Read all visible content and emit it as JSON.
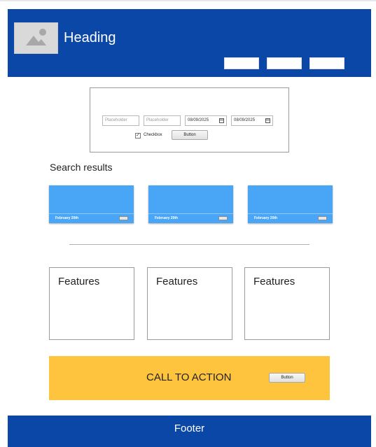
{
  "header": {
    "heading": "Heading",
    "nav_buttons": [
      "",
      "",
      ""
    ]
  },
  "search_form": {
    "field1_placeholder": "Placeholder",
    "field2_placeholder": "Placeholder",
    "date1": "08/09/2025",
    "date2": "08/09/2025",
    "checkbox_label": "Checkbox",
    "checkbox_checked": true,
    "button_label": "Button"
  },
  "results": {
    "title": "Search results",
    "cards": [
      {
        "date": "February 20th"
      },
      {
        "date": "February 20th"
      },
      {
        "date": "February 20th"
      }
    ]
  },
  "features": [
    {
      "label": "Features"
    },
    {
      "label": "Features"
    },
    {
      "label": "Features"
    }
  ],
  "cta": {
    "text": "CALL TO ACTION",
    "button_label": "Button"
  },
  "footer": {
    "text": "Footer"
  },
  "colors": {
    "header_bg": "#0b47a6",
    "card_bg": "#49a6f7",
    "cta_bg": "#fec43d"
  }
}
